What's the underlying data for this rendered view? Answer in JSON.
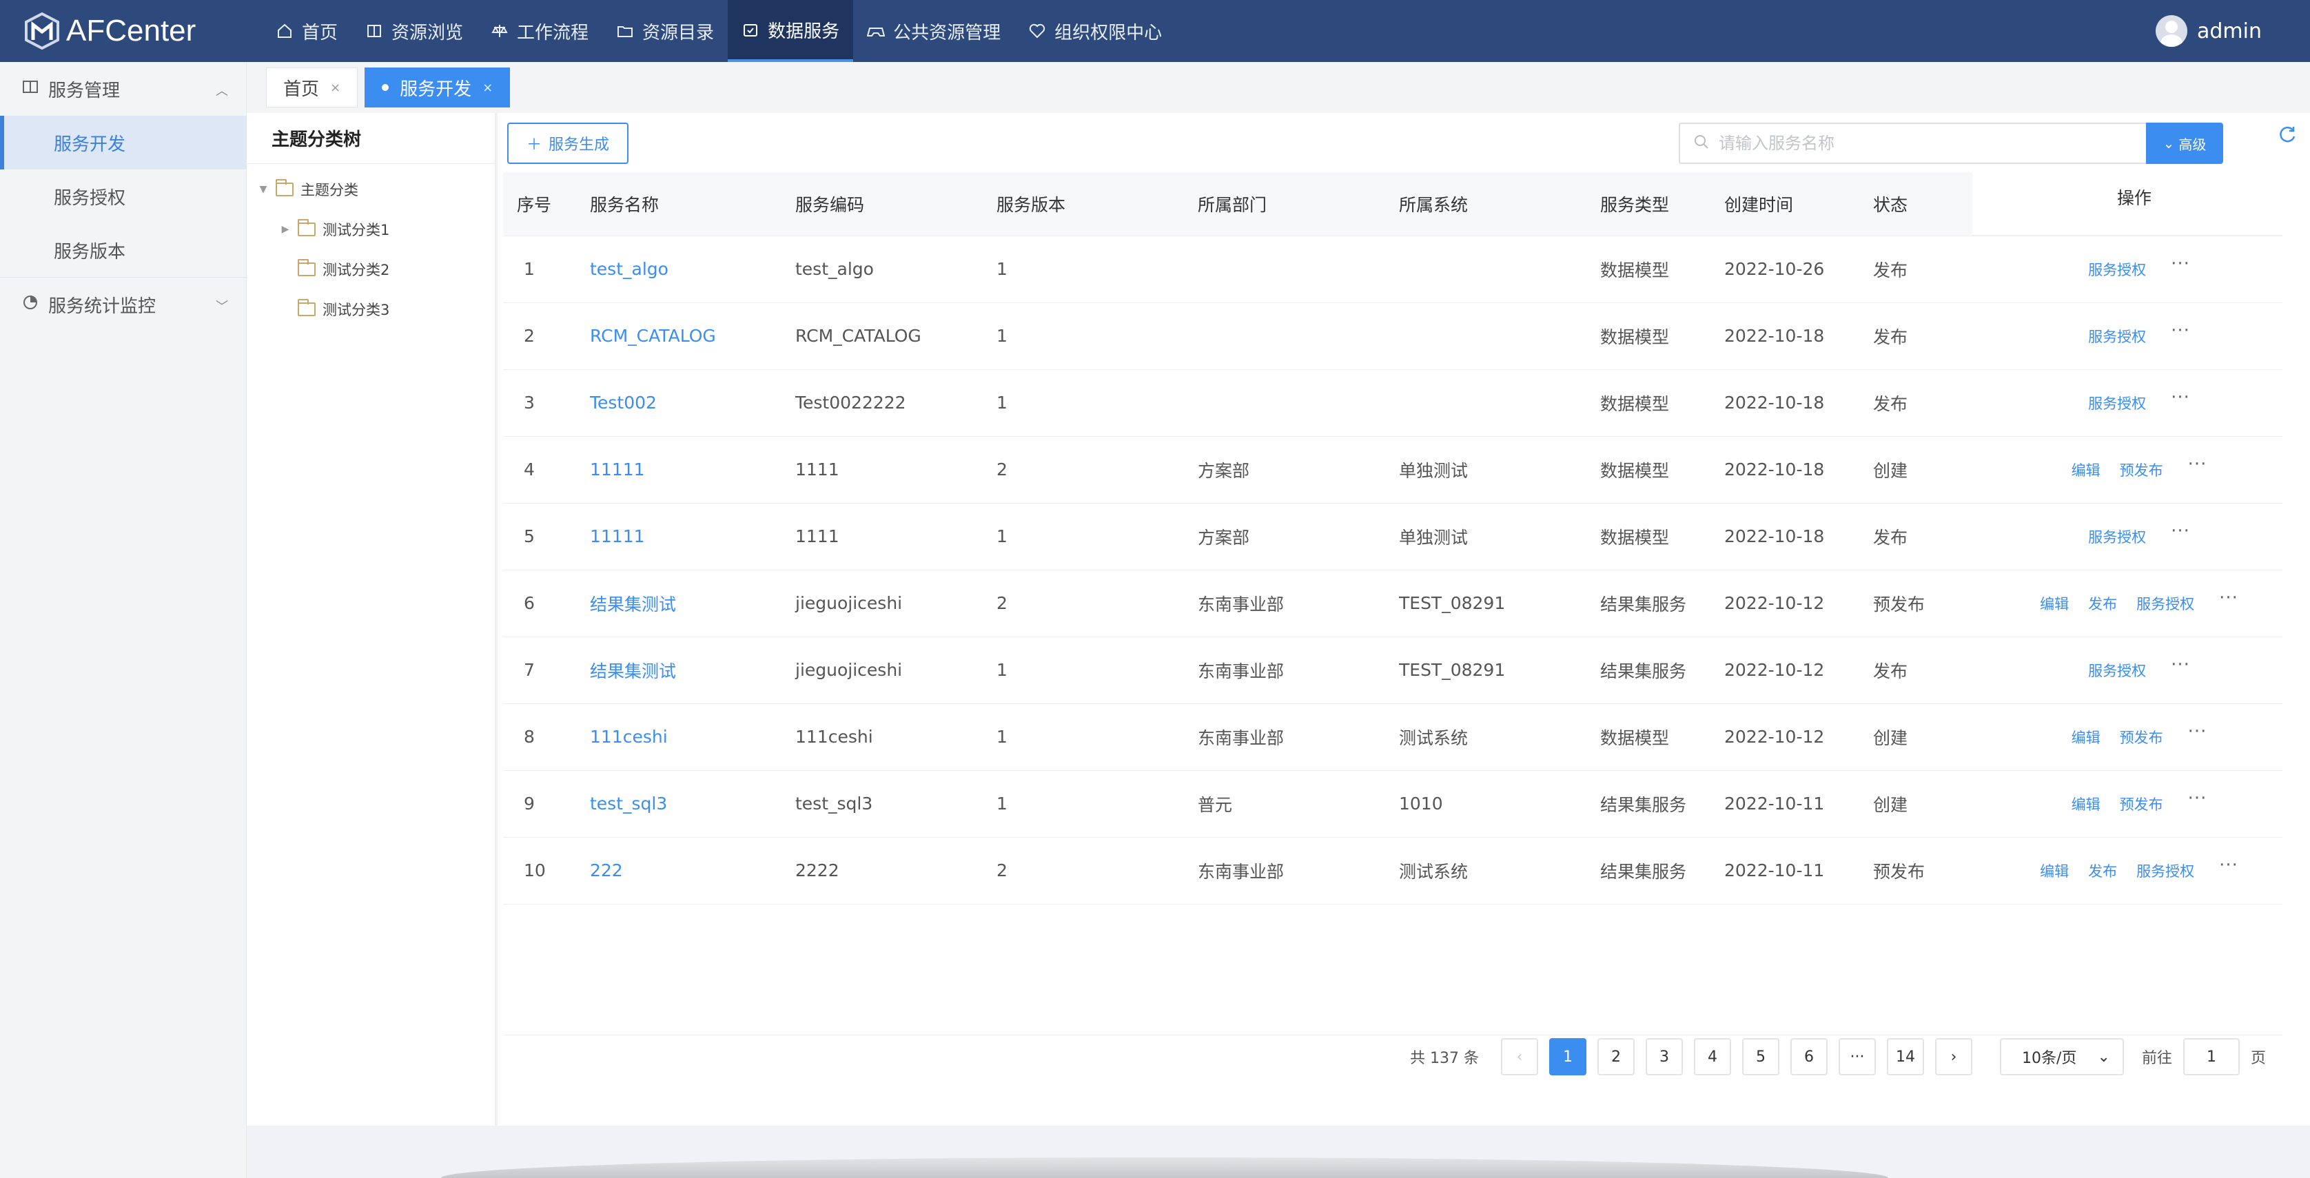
{
  "header": {
    "app_name": "AFCenter",
    "nav": [
      {
        "label": "首页",
        "icon": "home-icon"
      },
      {
        "label": "资源浏览",
        "icon": "book-icon"
      },
      {
        "label": "工作流程",
        "icon": "scale-icon"
      },
      {
        "label": "资源目录",
        "icon": "folder-icon"
      },
      {
        "label": "数据服务",
        "icon": "calendar-icon"
      },
      {
        "label": "公共资源管理",
        "icon": "gamepad-icon"
      },
      {
        "label": "组织权限中心",
        "icon": "heart-shield-icon"
      }
    ],
    "user_name": "admin"
  },
  "sidebar": {
    "group1": "服务管理",
    "items": [
      "服务开发",
      "服务授权",
      "服务版本"
    ],
    "group2": "服务统计监控"
  },
  "tabs": [
    {
      "label": "首页",
      "close": "×"
    },
    {
      "label": "服务开发",
      "close": "×"
    }
  ],
  "tree": {
    "title": "主题分类树",
    "root": "主题分类",
    "children": [
      "测试分类1",
      "测试分类2",
      "测试分类3"
    ]
  },
  "toolbar": {
    "add_label": "服务生成",
    "search_placeholder": "请输入服务名称",
    "advanced_label": "高级"
  },
  "table": {
    "headers": [
      "序号",
      "服务名称",
      "服务编码",
      "服务版本",
      "所属部门",
      "所属系统",
      "服务类型",
      "创建时间",
      "状态",
      "操作"
    ],
    "rows": [
      {
        "seq": "1",
        "name": "test_algo",
        "code": "test_algo",
        "version": "1",
        "dept": "",
        "system": "",
        "type": "数据模型",
        "created": "2022-10-26",
        "status": "发布",
        "ops": [
          "服务授权"
        ]
      },
      {
        "seq": "2",
        "name": "RCM_CATALOG",
        "code": "RCM_CATALOG",
        "version": "1",
        "dept": "",
        "system": "",
        "type": "数据模型",
        "created": "2022-10-18",
        "status": "发布",
        "ops": [
          "服务授权"
        ]
      },
      {
        "seq": "3",
        "name": "Test002",
        "code": "Test0022222",
        "version": "1",
        "dept": "",
        "system": "",
        "type": "数据模型",
        "created": "2022-10-18",
        "status": "发布",
        "ops": [
          "服务授权"
        ]
      },
      {
        "seq": "4",
        "name": "11111",
        "code": "1111",
        "version": "2",
        "dept": "方案部",
        "system": "单独测试",
        "type": "数据模型",
        "created": "2022-10-18",
        "status": "创建",
        "ops": [
          "编辑",
          "预发布"
        ]
      },
      {
        "seq": "5",
        "name": "11111",
        "code": "1111",
        "version": "1",
        "dept": "方案部",
        "system": "单独测试",
        "type": "数据模型",
        "created": "2022-10-18",
        "status": "发布",
        "ops": [
          "服务授权"
        ]
      },
      {
        "seq": "6",
        "name": "结果集测试",
        "code": "jieguojiceshi",
        "version": "2",
        "dept": "东南事业部",
        "system": "TEST_08291",
        "type": "结果集服务",
        "created": "2022-10-12",
        "status": "预发布",
        "ops": [
          "编辑",
          "发布",
          "服务授权"
        ]
      },
      {
        "seq": "7",
        "name": "结果集测试",
        "code": "jieguojiceshi",
        "version": "1",
        "dept": "东南事业部",
        "system": "TEST_08291",
        "type": "结果集服务",
        "created": "2022-10-12",
        "status": "发布",
        "ops": [
          "服务授权"
        ]
      },
      {
        "seq": "8",
        "name": "111ceshi",
        "code": "111ceshi",
        "version": "1",
        "dept": "东南事业部",
        "system": "测试系统",
        "type": "数据模型",
        "created": "2022-10-12",
        "status": "创建",
        "ops": [
          "编辑",
          "预发布"
        ]
      },
      {
        "seq": "9",
        "name": "test_sql3",
        "code": "test_sql3",
        "version": "1",
        "dept": "普元",
        "system": "1010",
        "type": "结果集服务",
        "created": "2022-10-11",
        "status": "创建",
        "ops": [
          "编辑",
          "预发布"
        ]
      },
      {
        "seq": "10",
        "name": "222",
        "code": "2222",
        "version": "2",
        "dept": "东南事业部",
        "system": "测试系统",
        "type": "结果集服务",
        "created": "2022-10-11",
        "status": "预发布",
        "ops": [
          "编辑",
          "发布",
          "服务授权"
        ]
      }
    ],
    "more_label": "···"
  },
  "pager": {
    "total": "共 137 条",
    "pages": [
      "1",
      "2",
      "3",
      "4",
      "5",
      "6",
      "···",
      "14"
    ],
    "current": "1",
    "page_size": "10条/页",
    "goto_prefix": "前往",
    "goto_value": "1",
    "goto_suffix": "页"
  },
  "colors": {
    "header_bg": "#2e4a7c",
    "accent": "#3b8ef0"
  }
}
